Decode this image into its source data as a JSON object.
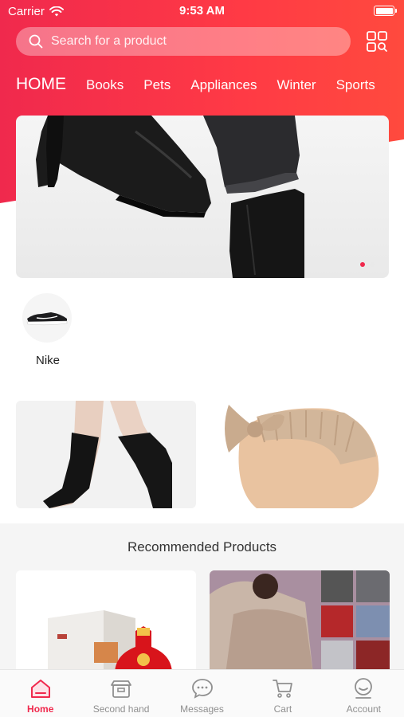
{
  "status_bar": {
    "carrier": "Carrier",
    "time": "9:53 AM"
  },
  "search": {
    "placeholder": "Search for a product"
  },
  "tabs": [
    {
      "label": "HOME",
      "active": true
    },
    {
      "label": "Books"
    },
    {
      "label": "Pets"
    },
    {
      "label": "Appliances"
    },
    {
      "label": "Winter"
    },
    {
      "label": "Sports"
    }
  ],
  "banner": {
    "slides": 2,
    "active_slide": 1
  },
  "brands": [
    {
      "name": "Nike"
    }
  ],
  "recommended": {
    "title": "Recommended Products"
  },
  "tabbar": [
    {
      "label": "Home",
      "icon": "home-icon",
      "active": true
    },
    {
      "label": "Second hand",
      "icon": "box-icon"
    },
    {
      "label": "Messages",
      "icon": "chat-icon"
    },
    {
      "label": "Cart",
      "icon": "cart-icon"
    },
    {
      "label": "Account",
      "icon": "account-icon"
    }
  ],
  "colors": {
    "accent": "#f0294d",
    "tab_inactive": "#8f8f8f"
  }
}
